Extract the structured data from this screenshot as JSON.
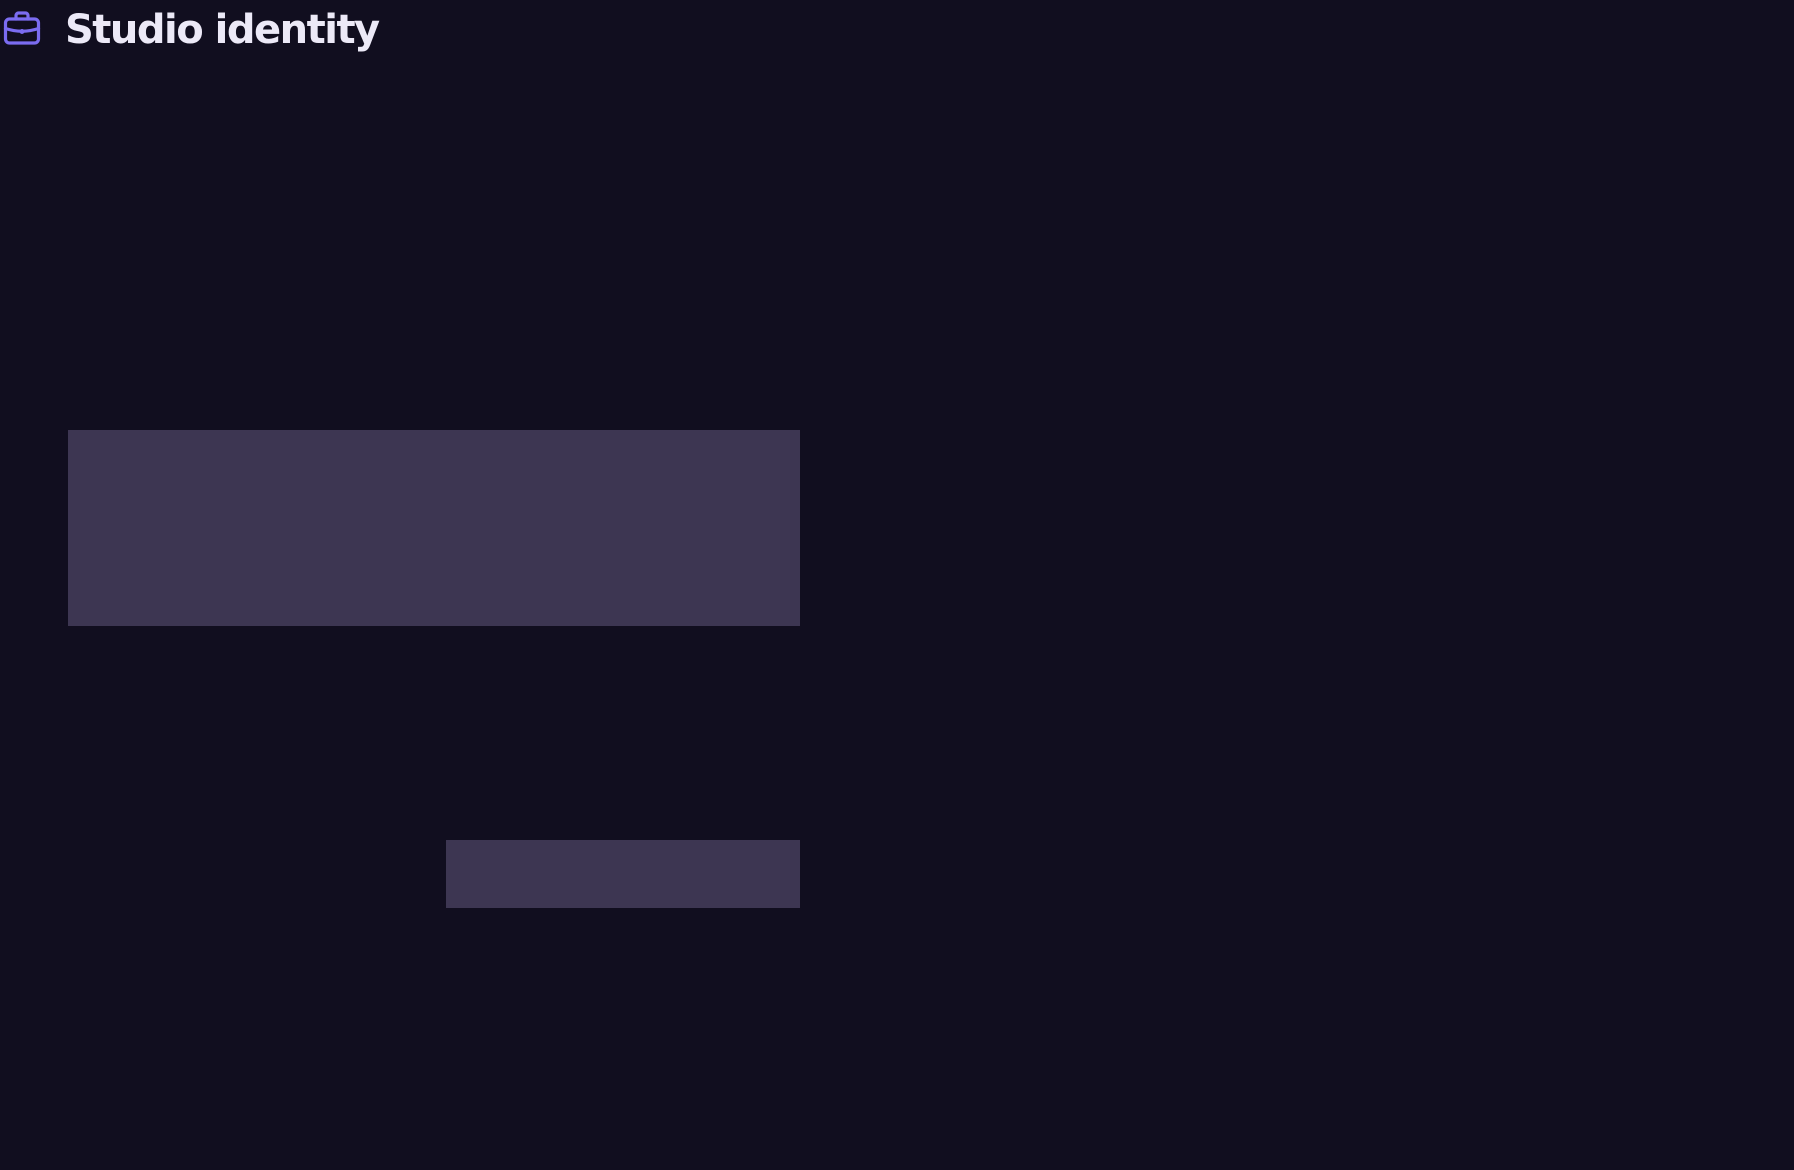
{
  "app": {
    "title": "Studio identity",
    "icon": "briefcase-icon"
  },
  "colors": {
    "background": "#110e1f",
    "accent": "#7b6cf0",
    "title_text": "#ece9f7",
    "placeholder_block": "#3d3652"
  }
}
